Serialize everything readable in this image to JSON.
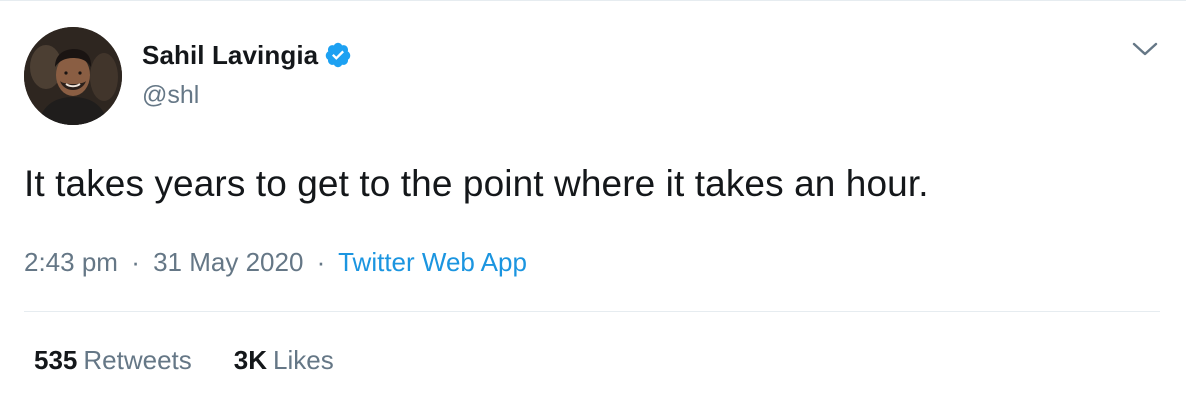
{
  "tweet": {
    "author": {
      "display_name": "Sahil Lavingia",
      "handle": "@shl",
      "verified": true,
      "avatar_icon": "avatar"
    },
    "text": "It takes years to get to the point where it takes an hour.",
    "meta": {
      "time": "2:43 pm",
      "separator": "·",
      "date": "31 May 2020",
      "source": "Twitter Web App"
    },
    "stats": {
      "retweets_count": "535",
      "retweets_label": "Retweets",
      "likes_count": "3K",
      "likes_label": "Likes"
    }
  },
  "colors": {
    "text_primary": "#14171a",
    "text_secondary": "#657786",
    "link": "#1b95e0",
    "verified": "#1da1f2",
    "divider": "#e6ecf0"
  },
  "icons": {
    "verified": "verified-badge-icon",
    "menu": "chevron-down-icon"
  }
}
